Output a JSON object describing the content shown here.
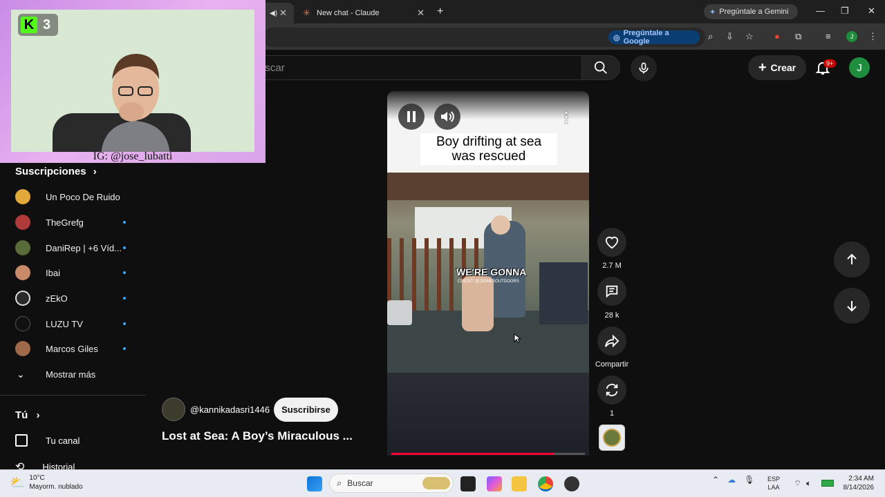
{
  "browser": {
    "tabs": [
      {
        "label": ""
      },
      {
        "label": "New chat - Claude"
      }
    ],
    "gemini_button": "Pregúntale a Gemini",
    "google_button": "Pregúntale a Google",
    "profile_initial": "J"
  },
  "header": {
    "search_placeholder": "Buscar",
    "create_label": "Crear",
    "notification_count": "9+",
    "avatar_initial": "J"
  },
  "webcam": {
    "badge_number": "3",
    "handle": "IG: @jose_lubatti"
  },
  "sidebar": {
    "subscriptions_title": "Suscripciones",
    "subscriptions": [
      {
        "name": "Un Poco De Ruido",
        "color": "#e0a93a",
        "new": false
      },
      {
        "name": "TheGrefg",
        "color": "#b03a3a",
        "new": true
      },
      {
        "name": "DaniRep | +6 Víd...",
        "color": "#5a6b3a",
        "new": true
      },
      {
        "name": "Ibai",
        "color": "#c98a6a",
        "new": true
      },
      {
        "name": "zEkO",
        "color": "#2a2a2a",
        "new": true
      },
      {
        "name": "LUZU TV",
        "color": "#111111",
        "new": true
      },
      {
        "name": "Marcos Giles",
        "color": "#a06a4a",
        "new": true
      }
    ],
    "show_more": "Mostrar más",
    "you_title": "Tú",
    "you_items": [
      {
        "label": "Tu canal"
      },
      {
        "label": "Historial"
      }
    ]
  },
  "short": {
    "caption": "Boy drifting at sea was rescued",
    "overlay_text": "WE'RE GONNA",
    "overlay_credit": "CREDIT: @JJONESOUTDOORS",
    "progress": 0.84,
    "channel": "@kannikadasri1446",
    "subscribe_label": "Suscribirse",
    "title": "Lost at Sea: A Boy’s Miraculous ..."
  },
  "actions": {
    "likes": "2.7 M",
    "comments": "28 k",
    "share": "Compartir",
    "remix": "1"
  },
  "taskbar": {
    "temperature": "10°C",
    "weather": "Mayorm. nublado",
    "search": "Buscar",
    "lang_1": "ESP",
    "lang_2": "LAA",
    "time": "2:34 AM",
    "date": "8/14/2026"
  },
  "colors": {
    "accent_red": "#ff0033",
    "new_dot": "#3ea6ff",
    "kick_green": "#53fc18"
  }
}
